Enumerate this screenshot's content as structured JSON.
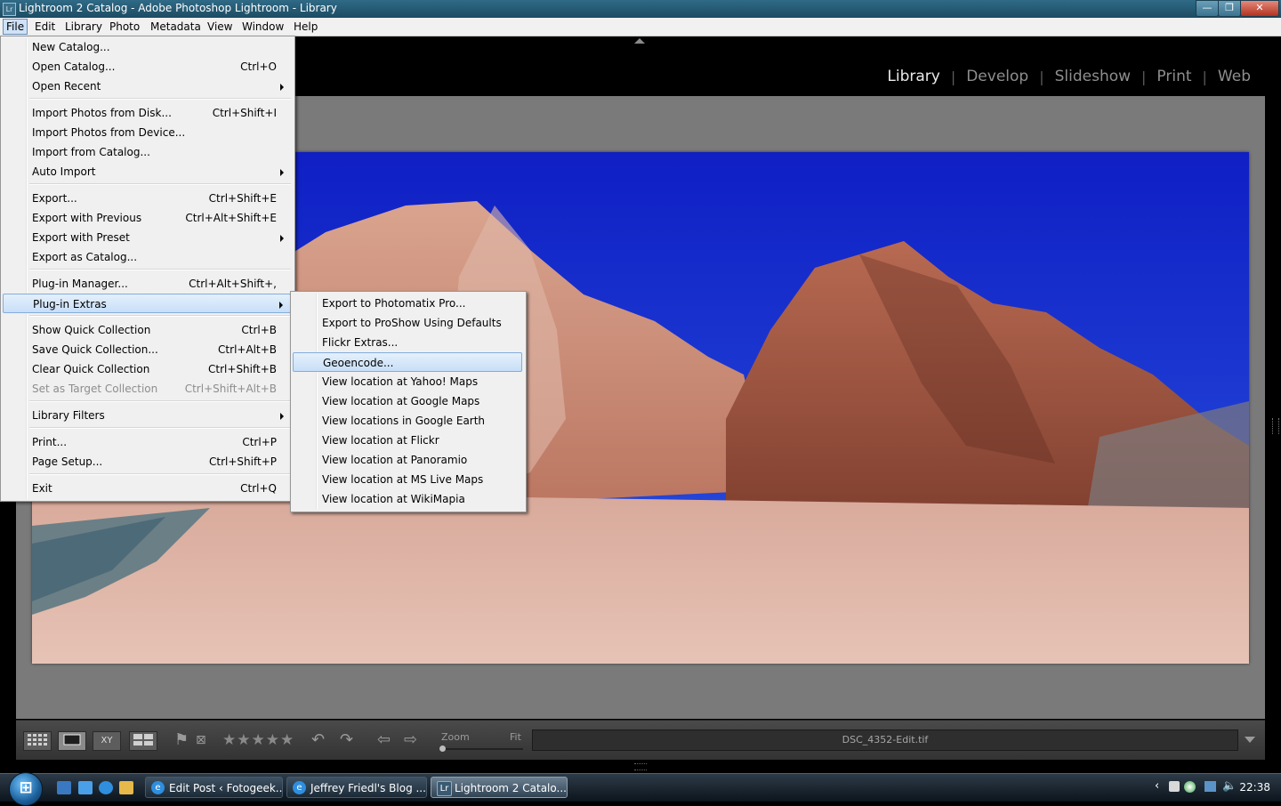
{
  "window": {
    "title": "Lightroom 2 Catalog - Adobe Photoshop Lightroom - Library",
    "app_icon": "Lr",
    "controls": {
      "minimize": "—",
      "maximize": "❐",
      "close": "✕"
    }
  },
  "menubar": {
    "items": [
      "File",
      "Edit",
      "Library",
      "Photo",
      "Metadata",
      "View",
      "Window",
      "Help"
    ],
    "active": "File"
  },
  "module_picker": {
    "modules": [
      "Library",
      "Develop",
      "Slideshow",
      "Print",
      "Web"
    ],
    "active": "Library",
    "separator": "|"
  },
  "file_menu": {
    "items": [
      {
        "label": "New Catalog...",
        "shortcut": ""
      },
      {
        "label": "Open Catalog...",
        "shortcut": "Ctrl+O"
      },
      {
        "label": "Open Recent",
        "shortcut": "",
        "submenu": true
      },
      {
        "label": "Import Photos from Disk...",
        "shortcut": "Ctrl+Shift+I"
      },
      {
        "label": "Import Photos from Device...",
        "shortcut": ""
      },
      {
        "label": "Import from Catalog...",
        "shortcut": ""
      },
      {
        "label": "Auto Import",
        "shortcut": "",
        "submenu": true
      },
      {
        "label": "Export...",
        "shortcut": "Ctrl+Shift+E"
      },
      {
        "label": "Export with Previous",
        "shortcut": "Ctrl+Alt+Shift+E"
      },
      {
        "label": "Export with Preset",
        "shortcut": "",
        "submenu": true
      },
      {
        "label": "Export as Catalog...",
        "shortcut": ""
      },
      {
        "label": "Plug-in Manager...",
        "shortcut": "Ctrl+Alt+Shift+,"
      },
      {
        "label": "Plug-in Extras",
        "shortcut": "",
        "submenu": true,
        "highlighted": true
      },
      {
        "label": "Show Quick Collection",
        "shortcut": "Ctrl+B"
      },
      {
        "label": "Save Quick Collection...",
        "shortcut": "Ctrl+Alt+B"
      },
      {
        "label": "Clear Quick Collection",
        "shortcut": "Ctrl+Shift+B"
      },
      {
        "label": "Set as Target Collection",
        "shortcut": "Ctrl+Shift+Alt+B",
        "disabled": true
      },
      {
        "label": "Library Filters",
        "shortcut": "",
        "submenu": true
      },
      {
        "label": "Print...",
        "shortcut": "Ctrl+P"
      },
      {
        "label": "Page Setup...",
        "shortcut": "Ctrl+Shift+P"
      },
      {
        "label": "Exit",
        "shortcut": "Ctrl+Q"
      }
    ]
  },
  "plugin_extras_menu": {
    "items": [
      "Export to Photomatix Pro...",
      "Export to ProShow Using Defaults",
      "Flickr Extras...",
      "Geoencode...",
      "View location at Yahoo! Maps",
      "View location at Google Maps",
      "View locations in Google Earth",
      "View location at Flickr",
      "View location at Panoramio",
      "View location at MS Live Maps",
      "View location at WikiMapia"
    ],
    "highlighted": "Geoencode..."
  },
  "toolbar": {
    "view_modes": [
      "grid-view-icon",
      "loupe-view-icon",
      "compare-view-icon",
      "survey-view-icon"
    ],
    "compare_label": "XY",
    "stars": "★★★★★",
    "zoom_label": "Zoom",
    "fit_label": "Fit",
    "filename": "DSC_4352-Edit.tif"
  },
  "taskbar": {
    "start": "⊞",
    "tasks": [
      {
        "label": "Edit Post ‹ Fotogeek...",
        "icon": "ie-icon"
      },
      {
        "label": "Jeffrey Friedl's Blog ...",
        "icon": "ie-icon"
      },
      {
        "label": "Lightroom 2 Catalo...",
        "icon": "lightroom-icon",
        "active": true
      }
    ],
    "clock": "22:38"
  },
  "colors": {
    "sky": "#1a2fd6",
    "accent_highlight": "#c7dff8",
    "lightroom_bg": "#7a7a7a"
  }
}
